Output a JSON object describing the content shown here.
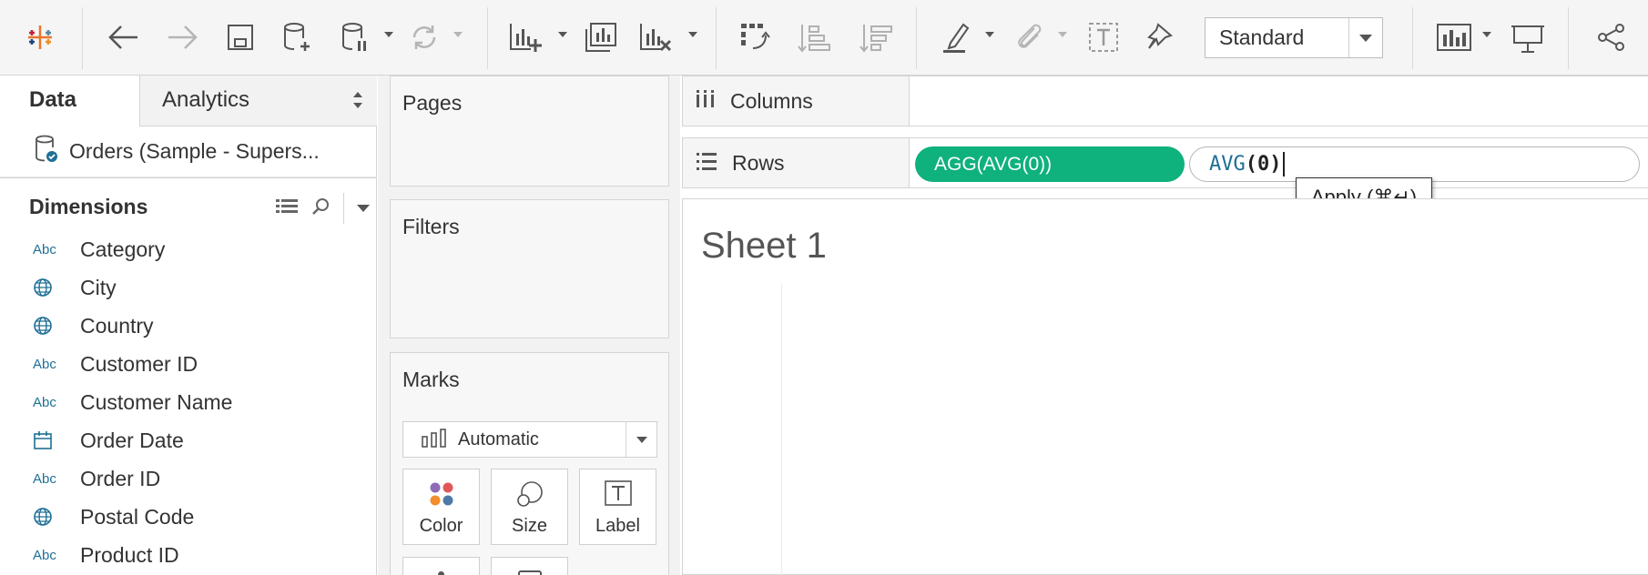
{
  "toolbar": {
    "view_mode": "Standard",
    "icons": [
      "tableau-logo-icon",
      "back-icon",
      "forward-icon",
      "save-icon",
      "new-data-source-icon",
      "pause-updates-icon",
      "refresh-icon",
      "new-worksheet-icon",
      "duplicate-sheet-icon",
      "clear-sheet-icon",
      "swap-rows-columns-icon",
      "sort-ascending-icon",
      "sort-descending-icon",
      "highlight-icon",
      "group-members-icon",
      "show-mark-labels-icon",
      "fix-axes-icon",
      "show-me-icon",
      "presentation-mode-icon",
      "share-icon"
    ]
  },
  "left_pane": {
    "tabs": {
      "data": "Data",
      "analytics": "Analytics"
    },
    "data_source": "Orders (Sample - Supers...",
    "dimensions_title": "Dimensions",
    "dimensions": [
      {
        "type": "Abc",
        "label": "Category"
      },
      {
        "type": "geo",
        "label": "City"
      },
      {
        "type": "geo",
        "label": "Country"
      },
      {
        "type": "Abc",
        "label": "Customer ID"
      },
      {
        "type": "Abc",
        "label": "Customer Name"
      },
      {
        "type": "date",
        "label": "Order Date"
      },
      {
        "type": "Abc",
        "label": "Order ID"
      },
      {
        "type": "geo",
        "label": "Postal Code"
      },
      {
        "type": "Abc",
        "label": "Product ID"
      }
    ]
  },
  "cards": {
    "pages": "Pages",
    "filters": "Filters",
    "marks": "Marks",
    "mark_type": "Automatic",
    "mark_buttons": {
      "color": "Color",
      "size": "Size",
      "label": "Label"
    },
    "mark_colors": [
      "#8e6bb8",
      "#e15759",
      "#f28e2b",
      "#59a14f",
      "#4e79a7"
    ]
  },
  "shelves": {
    "columns": "Columns",
    "rows": "Rows",
    "row_pill": "AGG(AVG(0))",
    "formula_fn": "AVG",
    "formula_arg": "(0)",
    "apply_tooltip": "Apply (⌘↵)"
  },
  "sheet": {
    "title": "Sheet 1"
  },
  "colors": {
    "pill": "#0fb17c",
    "accent_blue": "#1f6f96"
  }
}
